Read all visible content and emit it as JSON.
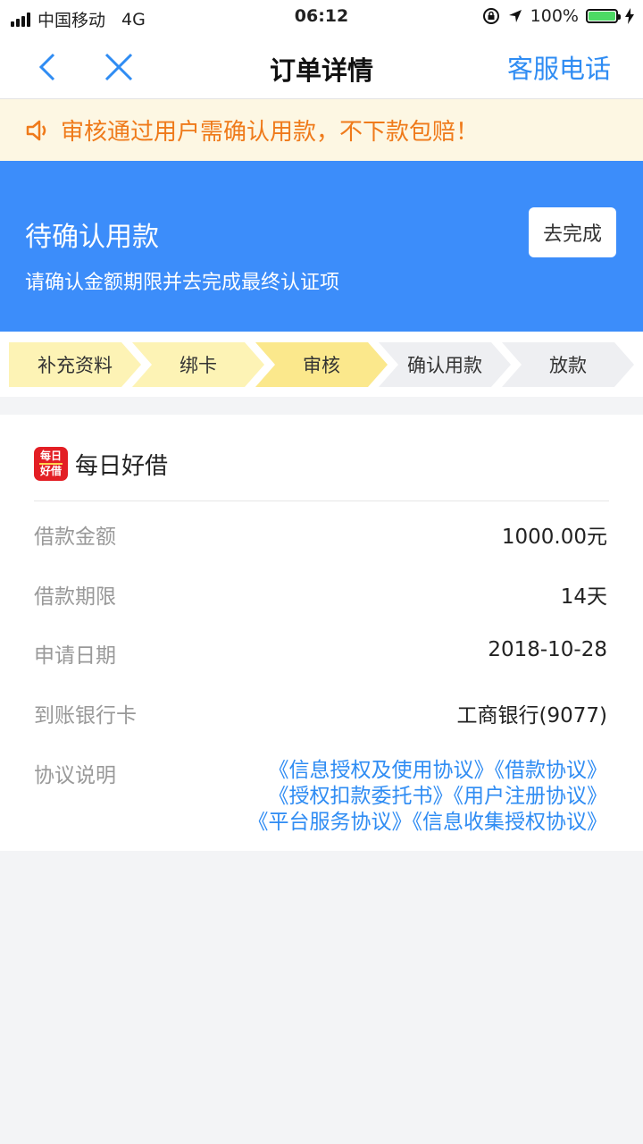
{
  "status_bar": {
    "carrier": "中国移动",
    "network": "4G",
    "time": "06:12",
    "battery": "100%"
  },
  "nav": {
    "title": "订单详情",
    "service": "客服电话"
  },
  "notice": {
    "text": "审核通过用户需确认用款，不下款包赔！"
  },
  "banner": {
    "title": "待确认用款",
    "subtitle": "请确认金额期限并去完成最终认证项",
    "button": "去完成",
    "color": "#3c8dfa"
  },
  "steps": [
    {
      "label": "补充资料",
      "done": true
    },
    {
      "label": "绑卡",
      "done": true
    },
    {
      "label": "审核",
      "done": true
    },
    {
      "label": "确认用款",
      "done": false
    },
    {
      "label": "放款",
      "done": false
    }
  ],
  "card": {
    "brand": {
      "name": "每日好借",
      "logo_top": "每日",
      "logo_bottom": "好借"
    },
    "rows": [
      {
        "label": "借款金额",
        "value": "1000.00元"
      },
      {
        "label": "借款期限",
        "value": "14天"
      },
      {
        "label": "申请日期",
        "value": "2018-10-28"
      },
      {
        "label": "到账银行卡",
        "value": "工商银行(9077)"
      }
    ],
    "agreement_label": "协议说明",
    "agreements": [
      "《信息授权及使用协议》",
      "《借款协议》",
      "《授权扣款委托书》",
      "《用户注册协议》",
      "《平台服务协议》",
      "《信息收集授权协议》"
    ]
  }
}
